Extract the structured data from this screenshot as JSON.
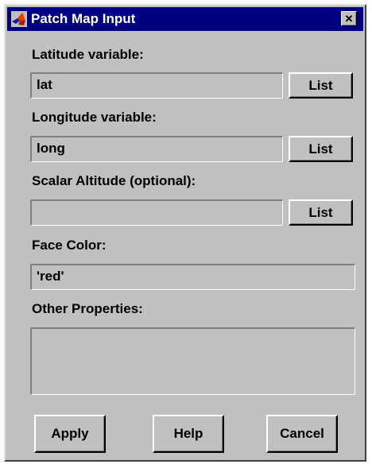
{
  "window": {
    "title": "Patch Map Input",
    "icon": "matlab-logo-icon",
    "close_glyph": "✕"
  },
  "fields": [
    {
      "label": "Latitude variable:",
      "value": "lat",
      "button": "List"
    },
    {
      "label": "Longitude variable:",
      "value": "long",
      "button": "List"
    },
    {
      "label": "Scalar Altitude (optional):",
      "value": "",
      "button": "List"
    }
  ],
  "face_color": {
    "label": "Face Color:",
    "value": "'red'"
  },
  "other_properties": {
    "label": "Other Properties:",
    "value": ""
  },
  "buttons": {
    "apply": "Apply",
    "help": "Help",
    "cancel": "Cancel"
  },
  "colors": {
    "titlebar": "#000080",
    "dialog_face": "#c0c0c0",
    "title_text": "#ffffff"
  }
}
